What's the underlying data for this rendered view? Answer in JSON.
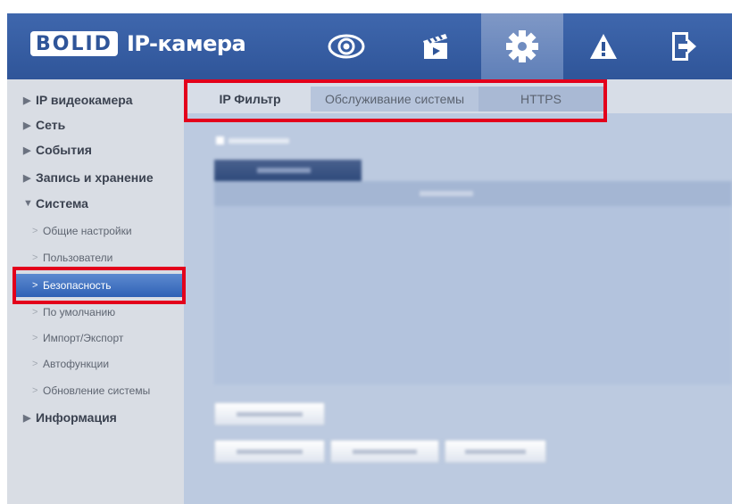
{
  "header": {
    "logo_text": "BOLID",
    "title": "IP-камера",
    "nav": [
      {
        "name": "live-view",
        "icon": "eye-icon",
        "active": false
      },
      {
        "name": "playback",
        "icon": "clapperboard-icon",
        "active": false
      },
      {
        "name": "settings",
        "icon": "gear-icon",
        "active": true
      },
      {
        "name": "alarm",
        "icon": "warning-icon",
        "active": false
      },
      {
        "name": "logout",
        "icon": "logout-icon",
        "active": false
      }
    ]
  },
  "sidebar": {
    "top": {
      "ip_camera": "IP видеокамера",
      "network": "Сеть",
      "events": "События",
      "storage": "Запись и хранение",
      "system": "Система",
      "info": "Информация"
    },
    "system_items": [
      {
        "label": "Общие настройки"
      },
      {
        "label": "Пользователи"
      },
      {
        "label": "Безопасность",
        "selected": true
      },
      {
        "label": "По умолчанию"
      },
      {
        "label": "Импорт/Экспорт"
      },
      {
        "label": "Автофункции"
      },
      {
        "label": "Обновление системы"
      }
    ]
  },
  "tabs": {
    "ip_filter": "IP Фильтр",
    "maintenance": "Обслуживание системы",
    "https": "HTTPS"
  },
  "colors": {
    "header": "#2f5599",
    "sidebar": "#d9dde4",
    "content": "#bccae0",
    "selected_item": "#2f62b5",
    "highlight_frame": "#e3001b"
  }
}
